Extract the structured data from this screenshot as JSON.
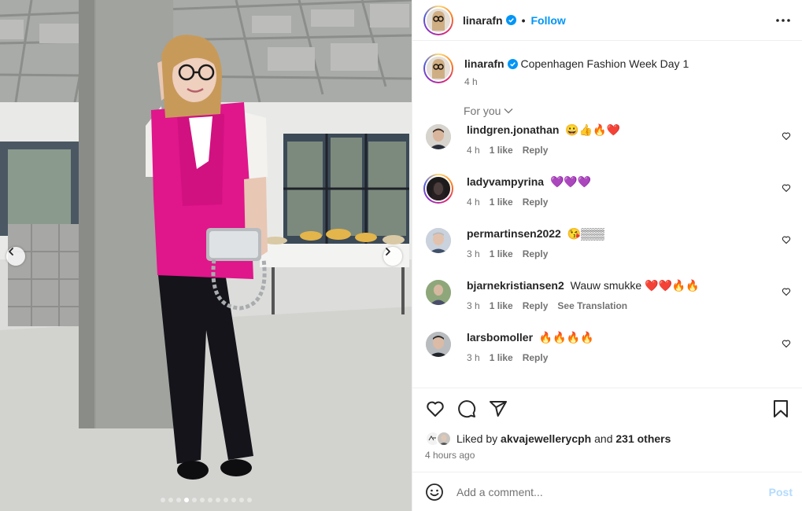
{
  "header": {
    "username": "linarafn",
    "separator": "•",
    "follow_label": "Follow"
  },
  "caption": {
    "username": "linarafn",
    "text": "Copenhagen Fashion Week Day 1",
    "time": "4 h"
  },
  "for_you_label": "For you",
  "comments": [
    {
      "username": "lindgren.jonathan",
      "text": "😀👍🔥❤️",
      "time": "4 h",
      "likes": "1 like",
      "reply": "Reply"
    },
    {
      "username": "ladyvampyrina",
      "text": "💜💜💜",
      "time": "4 h",
      "likes": "1 like",
      "reply": "Reply"
    },
    {
      "username": "permartinsen2022",
      "text": "😘▒▒▒",
      "time": "3 h",
      "likes": "1 like",
      "reply": "Reply"
    },
    {
      "username": "bjarnekristiansen2",
      "text": "Wauw smukke ❤️❤️🔥🔥",
      "time": "3 h",
      "likes": "1 like",
      "reply": "Reply",
      "translation": "See Translation"
    },
    {
      "username": "larsbomoller",
      "text": "🔥🔥🔥🔥",
      "time": "3 h",
      "likes": "1 like",
      "reply": "Reply"
    }
  ],
  "likes": {
    "prefix": "Liked by",
    "user": "akvajewellerycph",
    "and": "and",
    "others": "231 others"
  },
  "time_ago": "4 hours ago",
  "add_comment": {
    "placeholder": "Add a comment...",
    "post_label": "Post"
  },
  "carousel": {
    "slide_count": 12,
    "active_slide": 4
  },
  "icons": [
    "verified-icon",
    "more-icon",
    "heart-icon",
    "comment-icon",
    "share-icon",
    "save-icon",
    "emoji-icon",
    "chevron-left-icon",
    "chevron-right-icon",
    "chevron-down-icon"
  ],
  "colors": {
    "accent": "#0095f6",
    "text": "#262626",
    "muted": "#737373",
    "post_disabled": "#b3dbff",
    "dress": "#e0168b"
  }
}
